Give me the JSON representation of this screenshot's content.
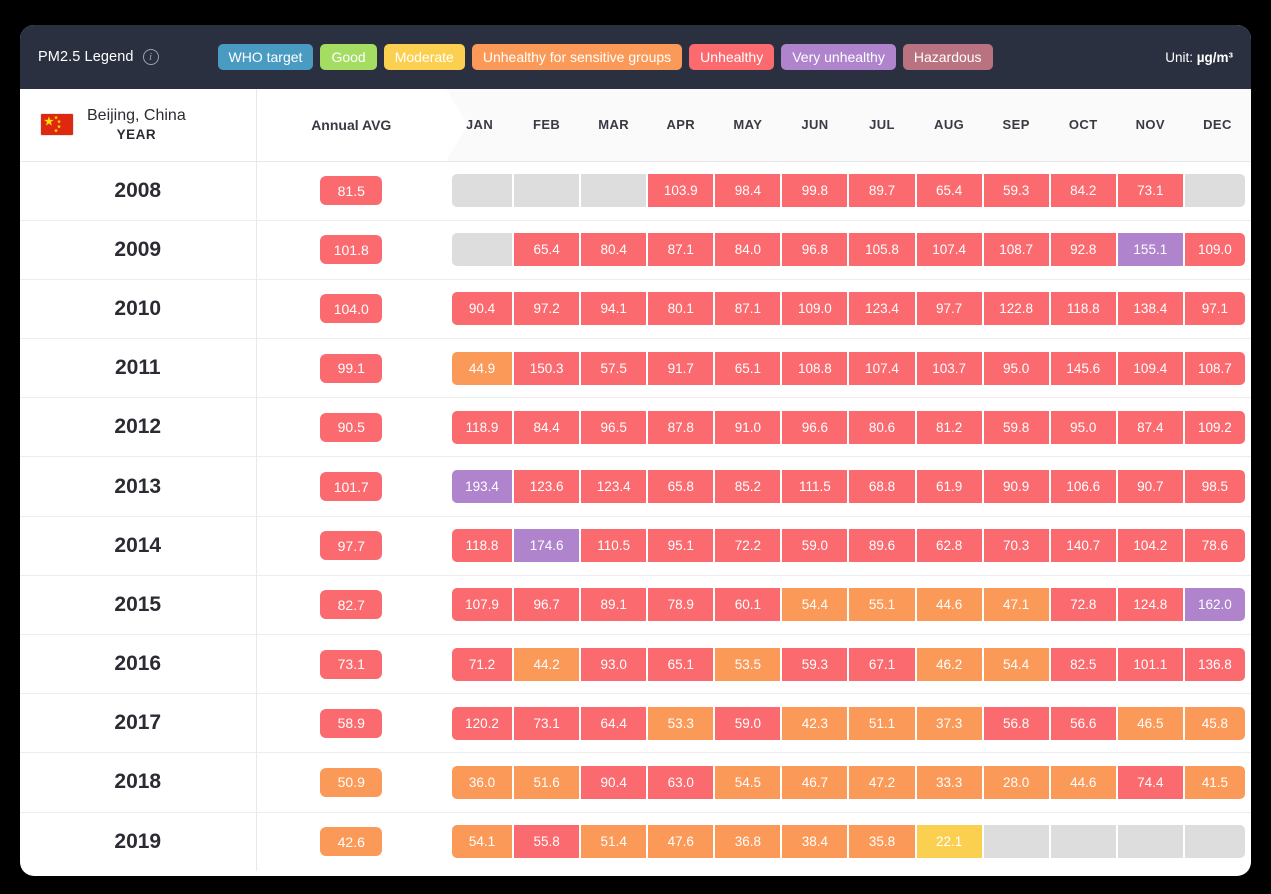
{
  "legend": {
    "title": "PM2.5 Legend",
    "info_icon": "info-icon",
    "unit_prefix": "Unit: ",
    "unit_value": "µg/m³",
    "chips": [
      {
        "label": "WHO target",
        "color": "#4a9bc1"
      },
      {
        "label": "Good",
        "color": "#a5dc62"
      },
      {
        "label": "Moderate",
        "color": "#fbd050"
      },
      {
        "label": "Unhealthy for sensitive groups",
        "color": "#fb9a58"
      },
      {
        "label": "Unhealthy",
        "color": "#fa6a6f"
      },
      {
        "label": "Very unhealthy",
        "color": "#af84cd"
      },
      {
        "label": "Hazardous",
        "color": "#b9727f"
      }
    ]
  },
  "header": {
    "flag": "china-flag-icon",
    "city": "Beijing, China",
    "row_label": "YEAR",
    "annual_avg": "Annual AVG",
    "months": [
      "JAN",
      "FEB",
      "MAR",
      "APR",
      "MAY",
      "JUN",
      "JUL",
      "AUG",
      "SEP",
      "OCT",
      "NOV",
      "DEC"
    ]
  },
  "colors": {
    "who_target": "#4a9bc1",
    "good": "#a5dc62",
    "moderate": "#fbd050",
    "sensitive": "#fb9a58",
    "unhealthy": "#fa6a6f",
    "very_unhealthy": "#af84cd",
    "hazardous": "#b9727f",
    "empty": "#dddddd",
    "legend_bg": "#2a3040",
    "card_bg": "#ffffff",
    "page_bg": "#000000"
  },
  "chart_data": {
    "type": "heatmap",
    "title": "PM2.5 Legend",
    "subtitle": "Beijing, China",
    "unit": "µg/m³",
    "xlabel": "",
    "ylabel": "YEAR",
    "x_categories": [
      "JAN",
      "FEB",
      "MAR",
      "APR",
      "MAY",
      "JUN",
      "JUL",
      "AUG",
      "SEP",
      "OCT",
      "NOV",
      "DEC"
    ],
    "y_categories": [
      "2008",
      "2009",
      "2010",
      "2011",
      "2012",
      "2013",
      "2014",
      "2015",
      "2016",
      "2017",
      "2018",
      "2019"
    ],
    "extra_column": "Annual AVG",
    "legend_position": "top",
    "color_scale": [
      {
        "name": "WHO target",
        "color": "#4a9bc1"
      },
      {
        "name": "Good",
        "color": "#a5dc62"
      },
      {
        "name": "Moderate",
        "color": "#fbd050"
      },
      {
        "name": "Unhealthy for sensitive groups",
        "color": "#fb9a58"
      },
      {
        "name": "Unhealthy",
        "color": "#fa6a6f"
      },
      {
        "name": "Very unhealthy",
        "color": "#af84cd"
      },
      {
        "name": "Hazardous",
        "color": "#b9727f"
      }
    ],
    "rows": [
      {
        "year": "2008",
        "annual_avg": "81.5",
        "annual_color": "#fa6a6f",
        "values": [
          "",
          "",
          "",
          "103.9",
          "98.4",
          "99.8",
          "89.7",
          "65.4",
          "59.3",
          "84.2",
          "73.1",
          ""
        ],
        "cell_colors": [
          "#dddddd",
          "#dddddd",
          "#dddddd",
          "#fa6a6f",
          "#fa6a6f",
          "#fa6a6f",
          "#fa6a6f",
          "#fa6a6f",
          "#fa6a6f",
          "#fa6a6f",
          "#fa6a6f",
          "#dddddd"
        ]
      },
      {
        "year": "2009",
        "annual_avg": "101.8",
        "annual_color": "#fa6a6f",
        "values": [
          "",
          "65.4",
          "80.4",
          "87.1",
          "84.0",
          "96.8",
          "105.8",
          "107.4",
          "108.7",
          "92.8",
          "155.1",
          "109.0"
        ],
        "cell_colors": [
          "#dddddd",
          "#fa6a6f",
          "#fa6a6f",
          "#fa6a6f",
          "#fa6a6f",
          "#fa6a6f",
          "#fa6a6f",
          "#fa6a6f",
          "#fa6a6f",
          "#fa6a6f",
          "#af84cd",
          "#fa6a6f"
        ]
      },
      {
        "year": "2010",
        "annual_avg": "104.0",
        "annual_color": "#fa6a6f",
        "values": [
          "90.4",
          "97.2",
          "94.1",
          "80.1",
          "87.1",
          "109.0",
          "123.4",
          "97.7",
          "122.8",
          "118.8",
          "138.4",
          "97.1"
        ],
        "cell_colors": [
          "#fa6a6f",
          "#fa6a6f",
          "#fa6a6f",
          "#fa6a6f",
          "#fa6a6f",
          "#fa6a6f",
          "#fa6a6f",
          "#fa6a6f",
          "#fa6a6f",
          "#fa6a6f",
          "#fa6a6f",
          "#fa6a6f"
        ]
      },
      {
        "year": "2011",
        "annual_avg": "99.1",
        "annual_color": "#fa6a6f",
        "values": [
          "44.9",
          "150.3",
          "57.5",
          "91.7",
          "65.1",
          "108.8",
          "107.4",
          "103.7",
          "95.0",
          "145.6",
          "109.4",
          "108.7"
        ],
        "cell_colors": [
          "#fb9a58",
          "#fa6a6f",
          "#fa6a6f",
          "#fa6a6f",
          "#fa6a6f",
          "#fa6a6f",
          "#fa6a6f",
          "#fa6a6f",
          "#fa6a6f",
          "#fa6a6f",
          "#fa6a6f",
          "#fa6a6f"
        ]
      },
      {
        "year": "2012",
        "annual_avg": "90.5",
        "annual_color": "#fa6a6f",
        "values": [
          "118.9",
          "84.4",
          "96.5",
          "87.8",
          "91.0",
          "96.6",
          "80.6",
          "81.2",
          "59.8",
          "95.0",
          "87.4",
          "109.2"
        ],
        "cell_colors": [
          "#fa6a6f",
          "#fa6a6f",
          "#fa6a6f",
          "#fa6a6f",
          "#fa6a6f",
          "#fa6a6f",
          "#fa6a6f",
          "#fa6a6f",
          "#fa6a6f",
          "#fa6a6f",
          "#fa6a6f",
          "#fa6a6f"
        ]
      },
      {
        "year": "2013",
        "annual_avg": "101.7",
        "annual_color": "#fa6a6f",
        "values": [
          "193.4",
          "123.6",
          "123.4",
          "65.8",
          "85.2",
          "111.5",
          "68.8",
          "61.9",
          "90.9",
          "106.6",
          "90.7",
          "98.5"
        ],
        "cell_colors": [
          "#af84cd",
          "#fa6a6f",
          "#fa6a6f",
          "#fa6a6f",
          "#fa6a6f",
          "#fa6a6f",
          "#fa6a6f",
          "#fa6a6f",
          "#fa6a6f",
          "#fa6a6f",
          "#fa6a6f",
          "#fa6a6f"
        ]
      },
      {
        "year": "2014",
        "annual_avg": "97.7",
        "annual_color": "#fa6a6f",
        "values": [
          "118.8",
          "174.6",
          "110.5",
          "95.1",
          "72.2",
          "59.0",
          "89.6",
          "62.8",
          "70.3",
          "140.7",
          "104.2",
          "78.6"
        ],
        "cell_colors": [
          "#fa6a6f",
          "#af84cd",
          "#fa6a6f",
          "#fa6a6f",
          "#fa6a6f",
          "#fa6a6f",
          "#fa6a6f",
          "#fa6a6f",
          "#fa6a6f",
          "#fa6a6f",
          "#fa6a6f",
          "#fa6a6f"
        ]
      },
      {
        "year": "2015",
        "annual_avg": "82.7",
        "annual_color": "#fa6a6f",
        "values": [
          "107.9",
          "96.7",
          "89.1",
          "78.9",
          "60.1",
          "54.4",
          "55.1",
          "44.6",
          "47.1",
          "72.8",
          "124.8",
          "162.0"
        ],
        "cell_colors": [
          "#fa6a6f",
          "#fa6a6f",
          "#fa6a6f",
          "#fa6a6f",
          "#fa6a6f",
          "#fb9a58",
          "#fb9a58",
          "#fb9a58",
          "#fb9a58",
          "#fa6a6f",
          "#fa6a6f",
          "#af84cd"
        ]
      },
      {
        "year": "2016",
        "annual_avg": "73.1",
        "annual_color": "#fa6a6f",
        "values": [
          "71.2",
          "44.2",
          "93.0",
          "65.1",
          "53.5",
          "59.3",
          "67.1",
          "46.2",
          "54.4",
          "82.5",
          "101.1",
          "136.8"
        ],
        "cell_colors": [
          "#fa6a6f",
          "#fb9a58",
          "#fa6a6f",
          "#fa6a6f",
          "#fb9a58",
          "#fa6a6f",
          "#fa6a6f",
          "#fb9a58",
          "#fb9a58",
          "#fa6a6f",
          "#fa6a6f",
          "#fa6a6f"
        ]
      },
      {
        "year": "2017",
        "annual_avg": "58.9",
        "annual_color": "#fa6a6f",
        "values": [
          "120.2",
          "73.1",
          "64.4",
          "53.3",
          "59.0",
          "42.3",
          "51.1",
          "37.3",
          "56.8",
          "56.6",
          "46.5",
          "45.8"
        ],
        "cell_colors": [
          "#fa6a6f",
          "#fa6a6f",
          "#fa6a6f",
          "#fb9a58",
          "#fa6a6f",
          "#fb9a58",
          "#fb9a58",
          "#fb9a58",
          "#fa6a6f",
          "#fa6a6f",
          "#fb9a58",
          "#fb9a58"
        ]
      },
      {
        "year": "2018",
        "annual_avg": "50.9",
        "annual_color": "#fb9a58",
        "values": [
          "36.0",
          "51.6",
          "90.4",
          "63.0",
          "54.5",
          "46.7",
          "47.2",
          "33.3",
          "28.0",
          "44.6",
          "74.4",
          "41.5"
        ],
        "cell_colors": [
          "#fb9a58",
          "#fb9a58",
          "#fa6a6f",
          "#fa6a6f",
          "#fb9a58",
          "#fb9a58",
          "#fb9a58",
          "#fb9a58",
          "#fb9a58",
          "#fb9a58",
          "#fa6a6f",
          "#fb9a58"
        ]
      },
      {
        "year": "2019",
        "annual_avg": "42.6",
        "annual_color": "#fb9a58",
        "values": [
          "54.1",
          "55.8",
          "51.4",
          "47.6",
          "36.8",
          "38.4",
          "35.8",
          "22.1",
          "",
          "",
          "",
          ""
        ],
        "cell_colors": [
          "#fb9a58",
          "#fa6a6f",
          "#fb9a58",
          "#fb9a58",
          "#fb9a58",
          "#fb9a58",
          "#fb9a58",
          "#fbd050",
          "#dddddd",
          "#dddddd",
          "#dddddd",
          "#dddddd"
        ]
      }
    ]
  }
}
